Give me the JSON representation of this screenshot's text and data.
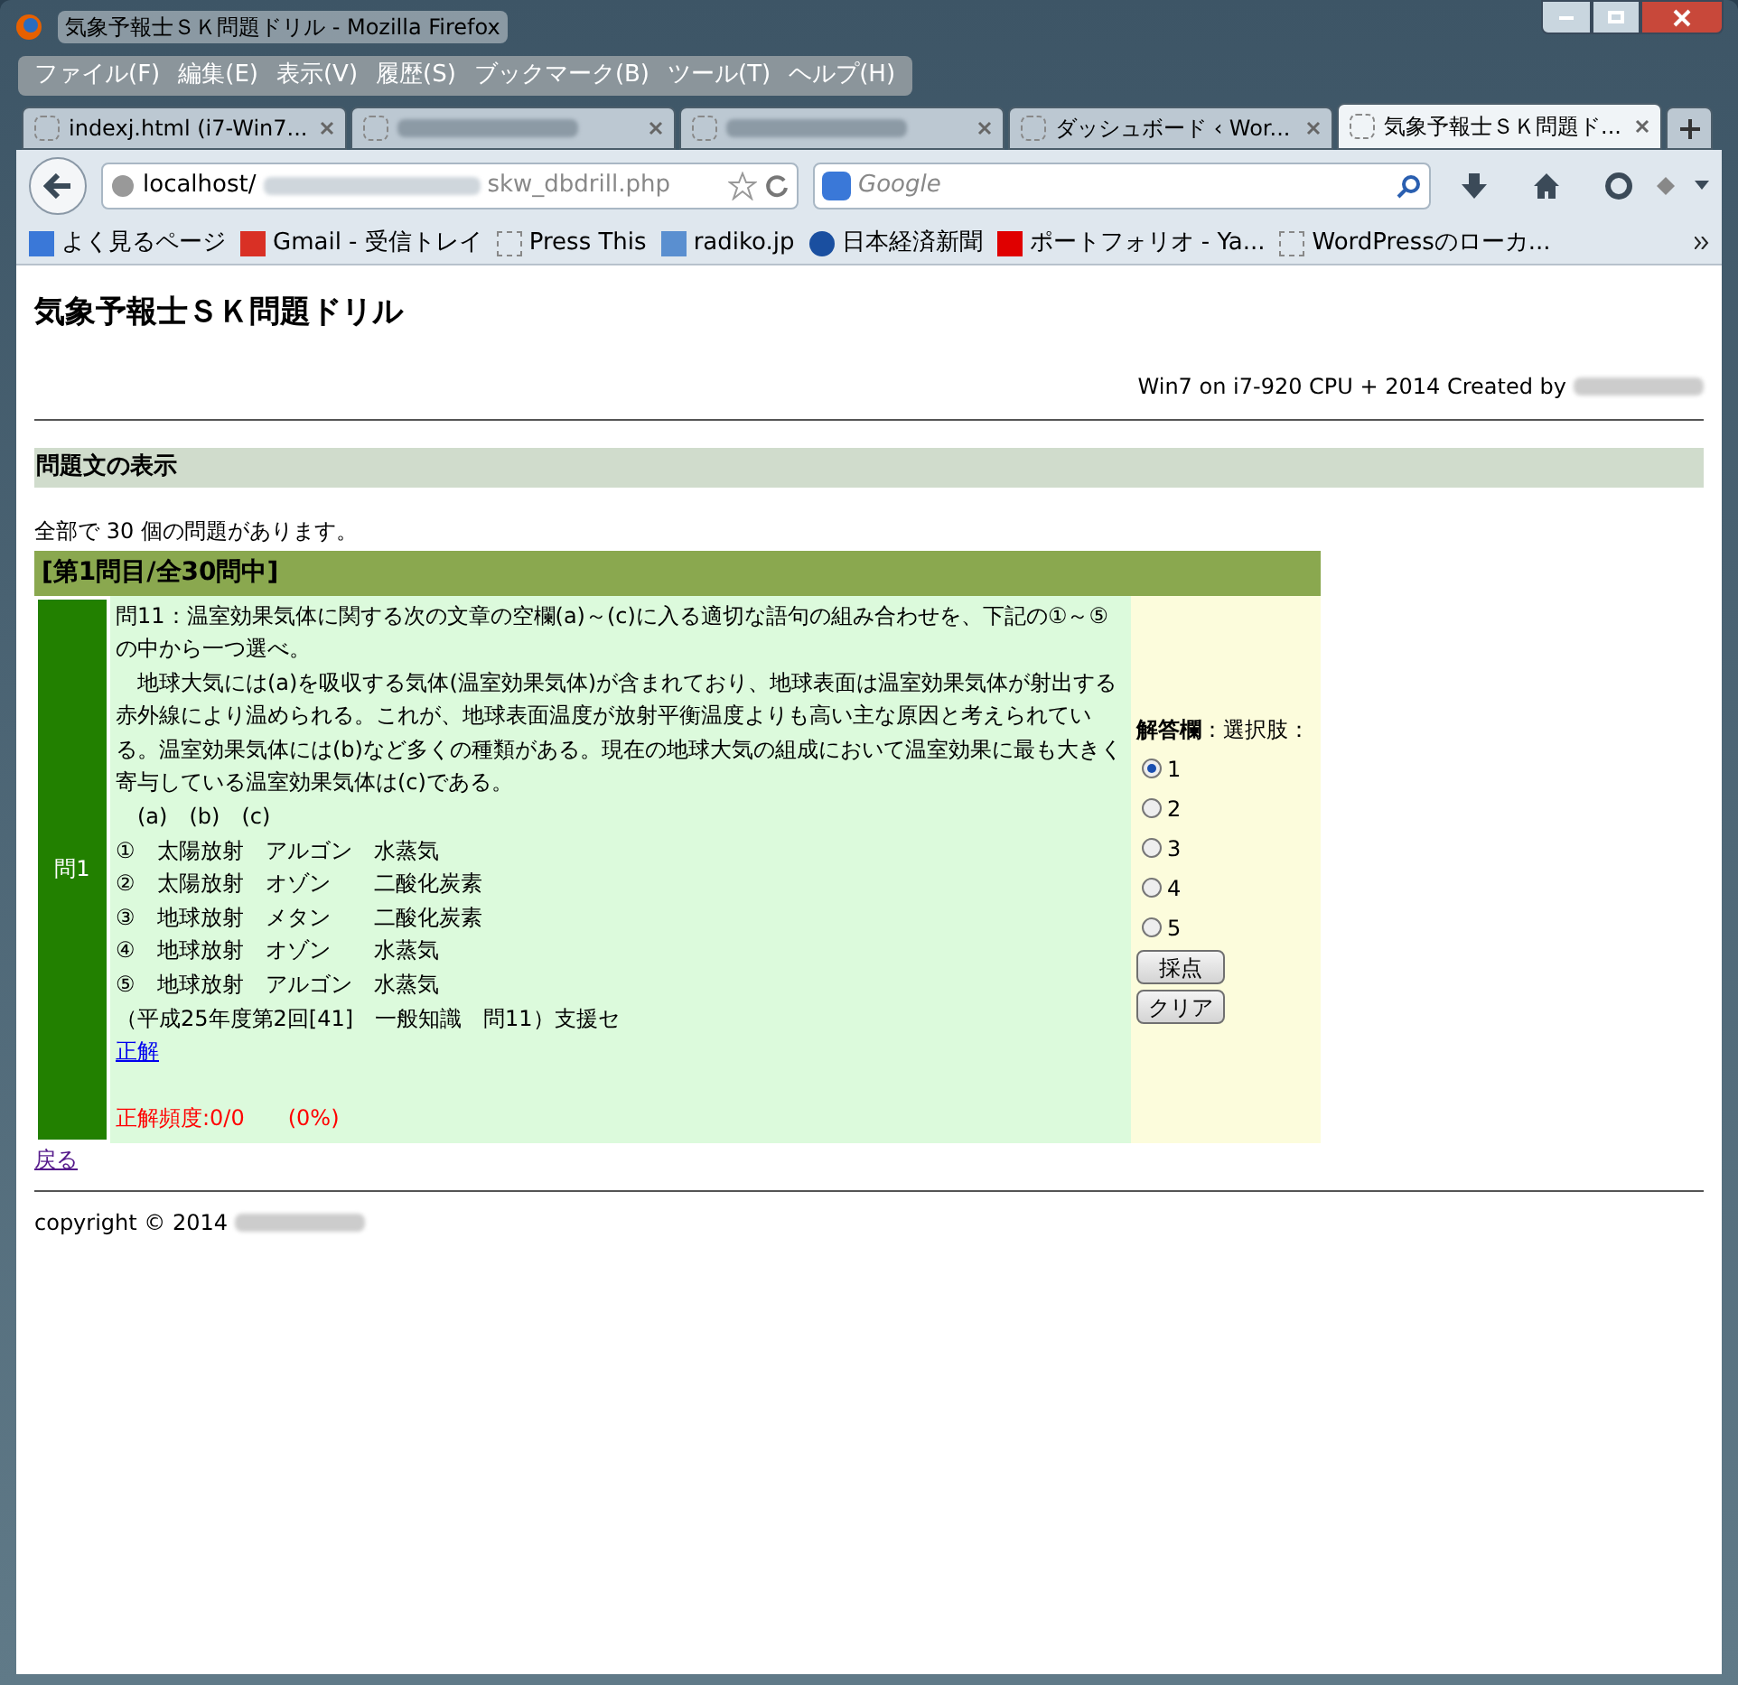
{
  "window": {
    "title": "気象予報士ＳＫ問題ドリル - Mozilla Firefox"
  },
  "menu": [
    "ファイル(F)",
    "編集(E)",
    "表示(V)",
    "履歴(S)",
    "ブックマーク(B)",
    "ツール(T)",
    "ヘルプ(H)"
  ],
  "tabs": [
    {
      "label": "indexj.html (i7-Win7...",
      "selected": false,
      "blurred": false
    },
    {
      "selected": false,
      "blurred": true
    },
    {
      "selected": false,
      "blurred": true
    },
    {
      "label": "ダッシュボード ‹ Wor...",
      "selected": false,
      "blurred": false
    },
    {
      "label": "気象予報士ＳＫ問題ド...",
      "selected": true,
      "blurred": false
    }
  ],
  "address": {
    "start": "localhost/",
    "end": "skw_dbdrill.php"
  },
  "search": {
    "placeholder": "Google"
  },
  "bookmarks": [
    {
      "label": "よく見るページ",
      "kind": "page"
    },
    {
      "label": "Gmail - 受信トレイ",
      "kind": "gmail"
    },
    {
      "label": "Press This",
      "kind": "blank"
    },
    {
      "label": "radiko.jp",
      "kind": "radio"
    },
    {
      "label": "日本経済新聞",
      "kind": "news"
    },
    {
      "label": "ポートフォリオ - Ya...",
      "kind": "yahoo"
    },
    {
      "label": "WordPressのローカ...",
      "kind": "blank"
    }
  ],
  "page": {
    "title": "気象予報士ＳＫ問題ドリル",
    "credit": "Win7 on i7-920 CPU + 2014 Created by",
    "section": "問題文の表示",
    "count_text": "全部で 30 個の問題があります。",
    "question": {
      "header": "[第1問目/全30問中]",
      "number": "問1",
      "lines": [
        "問11：温室効果気体に関する次の文章の空欄(a)～(c)に入る適切な語句の組み合わせを、下記の①～⑤の中から一つ選べ。",
        "　地球大気には(a)を吸収する気体(温室効果気体)が含まれており、地球表面は温室効果気体が射出する赤外線により温められる。これが、地球表面温度が放射平衡温度よりも高い主な原因と考えられている。温室効果気体には(b)など多くの種類がある。現在の地球大気の組成において温室効果に最も大きく寄与している温室効果気体は(c)である。",
        "　(a)　(b)　(c)",
        "①　太陽放射　アルゴン　水蒸気",
        "②　太陽放射　オゾン　　二酸化炭素",
        "③　地球放射　メタン　　二酸化炭素",
        "④　地球放射　オゾン　　水蒸気",
        "⑤　地球放射　アルゴン　水蒸気",
        "（平成25年度第2回[41]　一般知識　問11）支援セ"
      ],
      "answer_link": "正解",
      "stats": "正解頻度:0/0　　(0%)",
      "answer_label": "**解答欄**：選択肢：",
      "options": [
        {
          "label": "1",
          "selected": true
        },
        {
          "label": "2",
          "selected": false
        },
        {
          "label": "3",
          "selected": false
        },
        {
          "label": "4",
          "selected": false
        },
        {
          "label": "5",
          "selected": false
        }
      ],
      "buttons": [
        "採点",
        "クリア"
      ]
    },
    "back_link": "戻る",
    "copyright": "copyright © 2014"
  }
}
